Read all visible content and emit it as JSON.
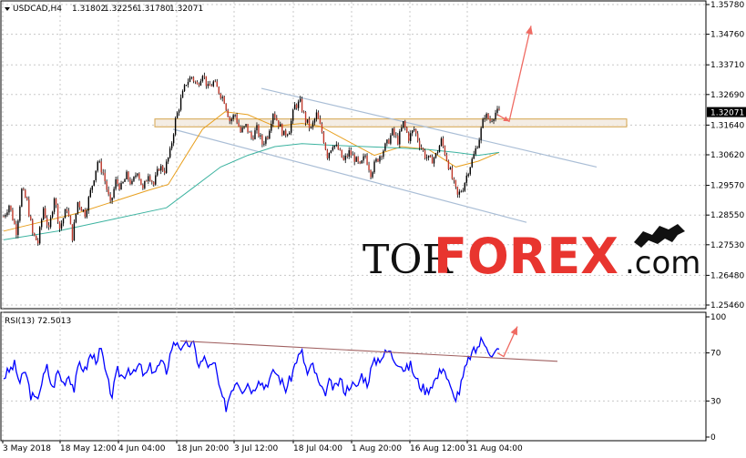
{
  "chart_data": [
    {
      "type": "candlestick",
      "symbol_header": "USDCAD,H4",
      "ohlc_header": [
        "1.31802",
        "1.32256",
        "1.31780",
        "1.32071"
      ],
      "current_price_label": "1.32071",
      "y_ticks": [
        "1.35780",
        "1.34760",
        "1.33710",
        "1.32690",
        "1.31640",
        "1.30620",
        "1.29570",
        "1.28550",
        "1.27530",
        "1.26480",
        "1.25460"
      ],
      "ylim": [
        1.2546,
        1.3578
      ],
      "x_ticks": [
        "3 May 2018",
        "18 May 12:00",
        "4 Jun 04:00",
        "18 Jun 20:00",
        "3 Jul 12:00",
        "18 Jul 04:00",
        "1 Aug 20:00",
        "16 Aug 12:00",
        "31 Aug 04:00"
      ],
      "grid": true,
      "series": [
        {
          "kind": "ohlc",
          "open_close_path": [
            [
              0,
              1.285
            ],
            [
              6,
              1.289
            ],
            [
              14,
              1.28
            ],
            [
              20,
              1.294
            ],
            [
              26,
              1.29
            ],
            [
              32,
              1.279
            ],
            [
              38,
              1.276
            ],
            [
              44,
              1.288
            ],
            [
              50,
              1.28
            ],
            [
              56,
              1.292
            ],
            [
              62,
              1.281
            ],
            [
              70,
              1.288
            ],
            [
              76,
              1.278
            ],
            [
              82,
              1.29
            ],
            [
              90,
              1.286
            ],
            [
              98,
              1.296
            ],
            [
              104,
              1.304
            ],
            [
              110,
              1.3
            ],
            [
              118,
              1.289
            ],
            [
              124,
              1.297
            ],
            [
              130,
              1.295
            ],
            [
              136,
              1.299
            ],
            [
              142,
              1.296
            ],
            [
              148,
              1.301
            ],
            [
              154,
              1.294
            ],
            [
              160,
              1.3
            ],
            [
              166,
              1.296
            ],
            [
              172,
              1.302
            ],
            [
              178,
              1.301
            ],
            [
              184,
              1.307
            ],
            [
              190,
              1.318
            ],
            [
              196,
              1.325
            ],
            [
              202,
              1.331
            ],
            [
              208,
              1.333
            ],
            [
              214,
              1.33
            ],
            [
              220,
              1.3345
            ],
            [
              226,
              1.329
            ],
            [
              232,
              1.331
            ],
            [
              238,
              1.328
            ],
            [
              244,
              1.325
            ],
            [
              250,
              1.318
            ],
            [
              256,
              1.32
            ],
            [
              262,
              1.314
            ],
            [
              268,
              1.316
            ],
            [
              274,
              1.312
            ],
            [
              280,
              1.315
            ],
            [
              286,
              1.31
            ],
            [
              292,
              1.313
            ],
            [
              298,
              1.321
            ],
            [
              304,
              1.317
            ],
            [
              310,
              1.313
            ],
            [
              316,
              1.315
            ],
            [
              322,
              1.323
            ],
            [
              328,
              1.324
            ],
            [
              334,
              1.318
            ],
            [
              340,
              1.315
            ],
            [
              346,
              1.32
            ],
            [
              352,
              1.314
            ],
            [
              358,
              1.306
            ],
            [
              364,
              1.31
            ],
            [
              370,
              1.308
            ],
            [
              376,
              1.304
            ],
            [
              382,
              1.307
            ],
            [
              388,
              1.305
            ],
            [
              394,
              1.302
            ],
            [
              400,
              1.306
            ],
            [
              406,
              1.3
            ],
            [
              412,
              1.304
            ],
            [
              418,
              1.307
            ],
            [
              424,
              1.31
            ],
            [
              430,
              1.314
            ],
            [
              436,
              1.311
            ],
            [
              442,
              1.317
            ],
            [
              448,
              1.312
            ],
            [
              454,
              1.315
            ],
            [
              460,
              1.31
            ],
            [
              466,
              1.306
            ],
            [
              472,
              1.304
            ],
            [
              478,
              1.306
            ],
            [
              484,
              1.311
            ],
            [
              490,
              1.305
            ],
            [
              496,
              1.298
            ],
            [
              502,
              1.292
            ],
            [
              508,
              1.295
            ],
            [
              514,
              1.301
            ],
            [
              520,
              1.306
            ],
            [
              526,
              1.312
            ],
            [
              532,
              1.32
            ],
            [
              538,
              1.318
            ],
            [
              544,
              1.3207
            ]
          ]
        },
        {
          "kind": "ma_fast",
          "color": "#e8a020",
          "values": [
            [
              0,
              1.28
            ],
            [
              40,
              1.283
            ],
            [
              80,
              1.286
            ],
            [
              120,
              1.29
            ],
            [
              160,
              1.294
            ],
            [
              182,
              1.296
            ],
            [
              200,
              1.305
            ],
            [
              220,
              1.315
            ],
            [
              245,
              1.321
            ],
            [
              270,
              1.32
            ],
            [
              300,
              1.316
            ],
            [
              330,
              1.317
            ],
            [
              350,
              1.316
            ],
            [
              380,
              1.311
            ],
            [
              410,
              1.306
            ],
            [
              440,
              1.309
            ],
            [
              470,
              1.308
            ],
            [
              500,
              1.302
            ],
            [
              525,
              1.304
            ],
            [
              548,
              1.307
            ]
          ]
        },
        {
          "kind": "ma_slow",
          "color": "#3cb3a0",
          "values": [
            [
              0,
              1.277
            ],
            [
              60,
              1.28
            ],
            [
              120,
              1.284
            ],
            [
              180,
              1.288
            ],
            [
              210,
              1.295
            ],
            [
              240,
              1.302
            ],
            [
              270,
              1.306
            ],
            [
              300,
              1.309
            ],
            [
              330,
              1.31
            ],
            [
              360,
              1.3095
            ],
            [
              400,
              1.309
            ],
            [
              440,
              1.3085
            ],
            [
              470,
              1.308
            ],
            [
              500,
              1.307
            ],
            [
              525,
              1.306
            ],
            [
              548,
              1.307
            ]
          ]
        }
      ],
      "channel_lines": [
        {
          "x1": 287,
          "y1": 1.329,
          "x2": 655,
          "y2": 1.302
        },
        {
          "x1": 190,
          "y1": 1.315,
          "x2": 578,
          "y2": 1.283
        }
      ],
      "zone": {
        "x1": 170,
        "x2": 688,
        "y_top": 1.3185,
        "y_bottom": 1.3158
      },
      "forecast_arrow": [
        [
          546,
          1.32
        ],
        [
          559,
          1.3177
        ],
        [
          583,
          1.3505
        ]
      ],
      "watermark": {
        "tor": "TOR",
        "forex": "FOREX",
        "dotcom": ".com"
      }
    },
    {
      "type": "line",
      "indicator_header": "RSI(13) 72.5013",
      "y_ticks": [
        "100",
        "70",
        "30",
        "0"
      ],
      "ylim": [
        0,
        100
      ],
      "series": [
        {
          "name": "RSI(13)",
          "color": "#0000ff",
          "values": [
            [
              0,
              50
            ],
            [
              6,
              55
            ],
            [
              12,
              60
            ],
            [
              18,
              45
            ],
            [
              24,
              55
            ],
            [
              30,
              35
            ],
            [
              36,
              30
            ],
            [
              42,
              45
            ],
            [
              48,
              58
            ],
            [
              54,
              40
            ],
            [
              60,
              55
            ],
            [
              66,
              45
            ],
            [
              72,
              52
            ],
            [
              78,
              40
            ],
            [
              84,
              62
            ],
            [
              90,
              55
            ],
            [
              96,
              68
            ],
            [
              102,
              65
            ],
            [
              108,
              72
            ],
            [
              114,
              48
            ],
            [
              120,
              35
            ],
            [
              126,
              55
            ],
            [
              132,
              50
            ],
            [
              138,
              58
            ],
            [
              144,
              52
            ],
            [
              150,
              60
            ],
            [
              156,
              50
            ],
            [
              162,
              58
            ],
            [
              168,
              55
            ],
            [
              174,
              62
            ],
            [
              180,
              55
            ],
            [
              186,
              75
            ],
            [
              192,
              80
            ],
            [
              198,
              72
            ],
            [
              204,
              78
            ],
            [
              210,
              76
            ],
            [
              216,
              60
            ],
            [
              222,
              65
            ],
            [
              228,
              58
            ],
            [
              234,
              60
            ],
            [
              240,
              35
            ],
            [
              246,
              25
            ],
            [
              252,
              40
            ],
            [
              258,
              48
            ],
            [
              264,
              40
            ],
            [
              270,
              45
            ],
            [
              276,
              38
            ],
            [
              282,
              50
            ],
            [
              288,
              42
            ],
            [
              294,
              48
            ],
            [
              300,
              55
            ],
            [
              306,
              48
            ],
            [
              312,
              40
            ],
            [
              318,
              50
            ],
            [
              324,
              65
            ],
            [
              330,
              70
            ],
            [
              336,
              52
            ],
            [
              342,
              60
            ],
            [
              348,
              45
            ],
            [
              354,
              35
            ],
            [
              360,
              45
            ],
            [
              366,
              40
            ],
            [
              372,
              48
            ],
            [
              378,
              38
            ],
            [
              384,
              45
            ],
            [
              390,
              40
            ],
            [
              396,
              52
            ],
            [
              402,
              45
            ],
            [
              408,
              60
            ],
            [
              414,
              65
            ],
            [
              420,
              68
            ],
            [
              426,
              72
            ],
            [
              432,
              65
            ],
            [
              438,
              62
            ],
            [
              444,
              55
            ],
            [
              450,
              60
            ],
            [
              456,
              48
            ],
            [
              462,
              42
            ],
            [
              468,
              38
            ],
            [
              474,
              45
            ],
            [
              480,
              50
            ],
            [
              486,
              60
            ],
            [
              492,
              45
            ],
            [
              498,
              32
            ],
            [
              504,
              38
            ],
            [
              510,
              55
            ],
            [
              516,
              68
            ],
            [
              522,
              72
            ],
            [
              528,
              80
            ],
            [
              534,
              78
            ],
            [
              540,
              66
            ],
            [
              546,
              72
            ]
          ]
        }
      ],
      "trend_line": {
        "x1": 198,
        "y1": 80,
        "x2": 612,
        "y2": 63
      },
      "forecast_arrow": [
        [
          546,
          70
        ],
        [
          553,
          67
        ],
        [
          568,
          92
        ]
      ]
    }
  ]
}
